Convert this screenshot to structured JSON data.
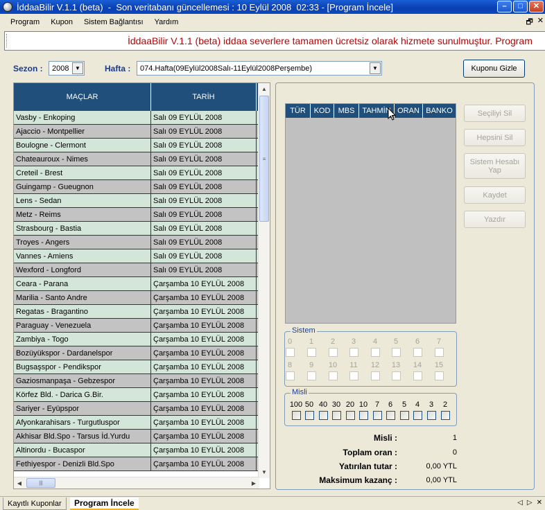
{
  "window": {
    "title": "İddaaBilir V.1.1 (beta)  -  Son veritabanı güncellemesi : 10 Eylül 2008  02:33 - [Program İncele]",
    "controls": {
      "minimize": "–",
      "maximize": "□",
      "close": "✕"
    }
  },
  "menu": {
    "items": [
      "Program",
      "Kupon",
      "Sistem Bağlantısı",
      "Yardım"
    ],
    "mdi": {
      "restore": "🗗",
      "close": "✕"
    }
  },
  "marquee": {
    "text": "İddaaBilir V.1.1 (beta) iddaa severlere tamamen ücretsiz olarak hizmete sunulmuştur. Program"
  },
  "filters": {
    "season_label": "Sezon :",
    "season_value": "2008",
    "week_label": "Hafta :",
    "week_value": "074.Hafta(09Eylül2008Salı-11Eylül2008Perşembe)",
    "hide_coupon_button": "Kuponu Gizle"
  },
  "matches": {
    "headers": [
      "MAÇLAR",
      "TARİH"
    ],
    "rows": [
      [
        "Vasby - Enkoping",
        "Salı 09 EYLÜL 2008"
      ],
      [
        "Ajaccio - Montpellier",
        "Salı 09 EYLÜL 2008"
      ],
      [
        "Boulogne - Clermont",
        "Salı 09 EYLÜL 2008"
      ],
      [
        "Chateauroux - Nimes",
        "Salı 09 EYLÜL 2008"
      ],
      [
        "Creteil - Brest",
        "Salı 09 EYLÜL 2008"
      ],
      [
        "Guingamp - Gueugnon",
        "Salı 09 EYLÜL 2008"
      ],
      [
        "Lens - Sedan",
        "Salı 09 EYLÜL 2008"
      ],
      [
        "Metz - Reims",
        "Salı 09 EYLÜL 2008"
      ],
      [
        "Strasbourg - Bastia",
        "Salı 09 EYLÜL 2008"
      ],
      [
        "Troyes - Angers",
        "Salı 09 EYLÜL 2008"
      ],
      [
        "Vannes - Amiens",
        "Salı 09 EYLÜL 2008"
      ],
      [
        "Wexford - Longford",
        "Salı 09 EYLÜL 2008"
      ],
      [
        "Ceara - Parana",
        "Çarşamba 10 EYLÜL 2008"
      ],
      [
        "Marilia - Santo Andre",
        "Çarşamba 10 EYLÜL 2008"
      ],
      [
        "Regatas - Bragantino",
        "Çarşamba 10 EYLÜL 2008"
      ],
      [
        "Paraguay - Venezuela",
        "Çarşamba 10 EYLÜL 2008"
      ],
      [
        "Zambiya - Togo",
        "Çarşamba 10 EYLÜL 2008"
      ],
      [
        "Bozüyükspor - Dardanelspor",
        "Çarşamba 10 EYLÜL 2008"
      ],
      [
        "Bugsaşspor - Pendikspor",
        "Çarşamba 10 EYLÜL 2008"
      ],
      [
        "Gaziosmanpaşa - Gebzespor",
        "Çarşamba 10 EYLÜL 2008"
      ],
      [
        "Körfez Bld. - Darica G.Bir.",
        "Çarşamba 10 EYLÜL 2008"
      ],
      [
        "Sariyer - Eyüpspor",
        "Çarşamba 10 EYLÜL 2008"
      ],
      [
        "Afyonkarahisars - Turgutluspor",
        "Çarşamba 10 EYLÜL 2008"
      ],
      [
        "Akhisar Bld.Spo - Tarsus İd.Yurdu",
        "Çarşamba 10 EYLÜL 2008"
      ],
      [
        "Altinordu - Bucaspor",
        "Çarşamba 10 EYLÜL 2008"
      ],
      [
        "Fethiyespor - Denizli Bld.Spo",
        "Çarşamba 10 EYLÜL 2008"
      ]
    ]
  },
  "coupon": {
    "headers": [
      "TÜR",
      "KOD",
      "MBS",
      "TAHMİN",
      "ORAN",
      "BANKO"
    ]
  },
  "actions": [
    {
      "label": "Seçiliyi Sil",
      "enabled": false
    },
    {
      "label": "Hepsini Sil",
      "enabled": false
    },
    {
      "label": "Sistem Hesabı Yap",
      "enabled": false
    },
    {
      "label": "Kaydet",
      "enabled": false
    },
    {
      "label": "Yazdır",
      "enabled": false
    }
  ],
  "sistem": {
    "title": "Sistem",
    "numbers": [
      "0",
      "1",
      "2",
      "3",
      "4",
      "5",
      "6",
      "7",
      "8",
      "9",
      "10",
      "11",
      "12",
      "13",
      "14",
      "15"
    ]
  },
  "misli": {
    "title": "Misli",
    "options": [
      "100",
      "50",
      "40",
      "30",
      "20",
      "10",
      "7",
      "6",
      "5",
      "4",
      "3",
      "2"
    ]
  },
  "summary": {
    "items": [
      {
        "label": "Misli :",
        "value": "1"
      },
      {
        "label": "Toplam oran :",
        "value": "0"
      },
      {
        "label": "Yatırılan tutar :",
        "value": "0,00 YTL"
      },
      {
        "label": "Maksimum kazanç :",
        "value": "0,00 YTL"
      }
    ]
  },
  "tabs": {
    "items": [
      {
        "label": "Kayıtlı Kuponlar",
        "active": false
      },
      {
        "label": "Program İncele",
        "active": true
      }
    ],
    "nav": {
      "prev": "◁",
      "next": "▷",
      "close": "✕"
    }
  },
  "colors": {
    "grid_header": "#1f4f7a",
    "row_even": "#d4e6da",
    "row_odd": "#c4c3c3",
    "marquee_text": "#c00000",
    "label_blue": "#1a3a8a"
  }
}
